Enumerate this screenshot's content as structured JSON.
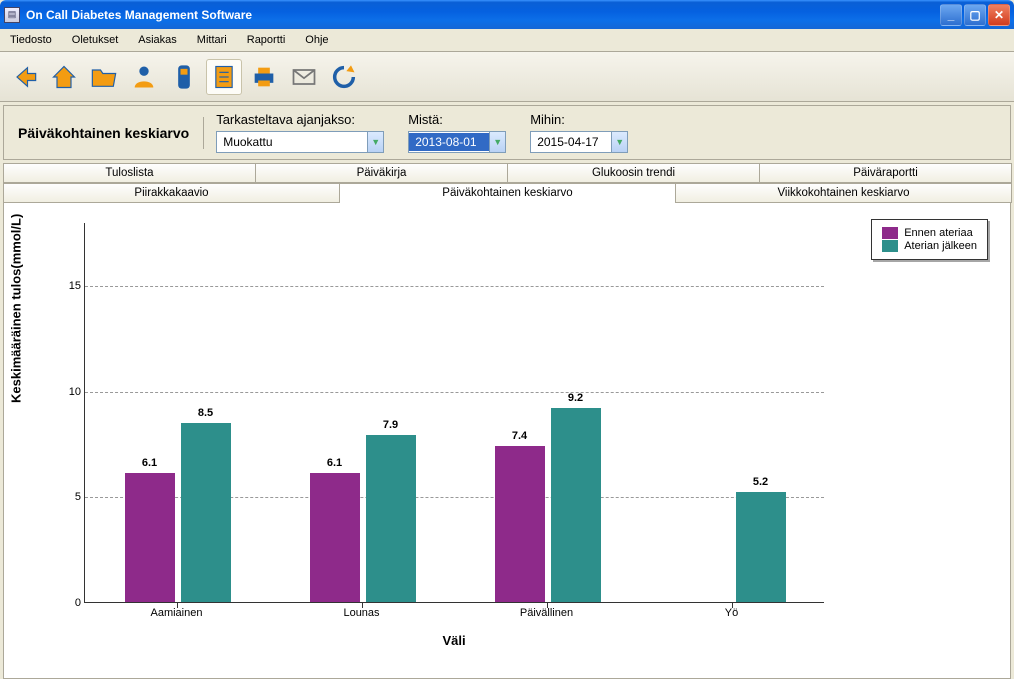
{
  "window": {
    "title": "On Call Diabetes Management Software"
  },
  "menu": [
    "Tiedosto",
    "Oletukset",
    "Asiakas",
    "Mittari",
    "Raportti",
    "Ohje"
  ],
  "toolbar_icons": [
    "back",
    "home",
    "folder",
    "person",
    "meter",
    "report",
    "printer",
    "mail",
    "refresh"
  ],
  "filter": {
    "view_label": "Päiväkohtainen keskiarvo",
    "range_label": "Tarkasteltava ajanjakso:",
    "range_value": "Muokattu",
    "from_label": "Mistä:",
    "from_value": "2013-08-01",
    "to_label": "Mihin:",
    "to_value": "2015-04-17"
  },
  "tabs": {
    "row1": [
      "Tuloslista",
      "Päiväkirja",
      "Glukoosin trendi",
      "Päiväraportti"
    ],
    "row2": [
      "Piirakkakaavio",
      "Päiväkohtainen keskiarvo",
      "Viikkokohtainen keskiarvo"
    ],
    "selected_row": 2,
    "selected_index": 1
  },
  "chart_data": {
    "type": "bar",
    "title": "",
    "xlabel": "Väli",
    "ylabel": "Keskimääräinen tulos(mmol/L)",
    "ylim": [
      0,
      18
    ],
    "yticks": [
      0,
      5,
      10,
      15
    ],
    "categories": [
      "Aamiainen",
      "Lounas",
      "Päivällinen",
      "Yö"
    ],
    "series": [
      {
        "name": "Ennen ateriaa",
        "color": "#8e2a8a",
        "values": [
          6.1,
          6.1,
          7.4,
          null
        ]
      },
      {
        "name": "Aterian jälkeen",
        "color": "#2d8f8b",
        "values": [
          8.5,
          7.9,
          9.2,
          5.2
        ]
      }
    ]
  }
}
